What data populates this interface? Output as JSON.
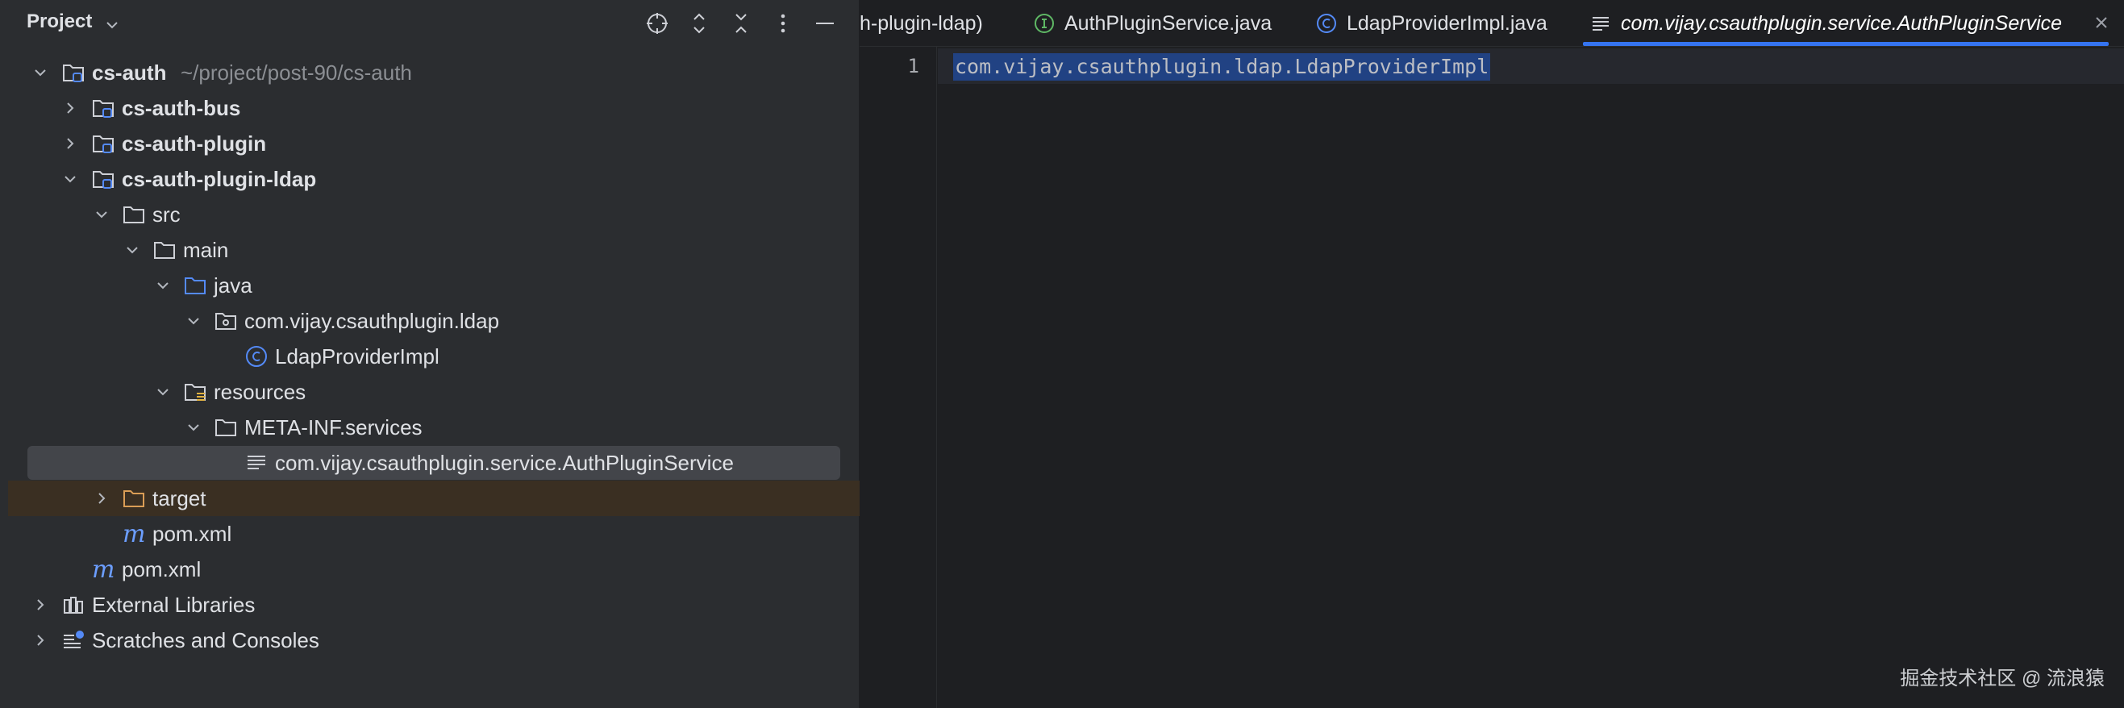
{
  "project_panel": {
    "title": "Project",
    "tree": [
      {
        "id": "cs-auth",
        "label": "cs-auth",
        "hint": "~/project/post-90/cs-auth",
        "icon": "module-folder-icon",
        "expanded": true,
        "bold": true
      },
      {
        "id": "cs-auth-bus",
        "label": "cs-auth-bus",
        "icon": "module-folder-icon",
        "expanded": false,
        "bold": true
      },
      {
        "id": "cs-auth-plugin",
        "label": "cs-auth-plugin",
        "icon": "module-folder-icon",
        "expanded": false,
        "bold": true
      },
      {
        "id": "cs-auth-plugin-ldap",
        "label": "cs-auth-plugin-ldap",
        "icon": "module-folder-icon",
        "expanded": true,
        "bold": true
      },
      {
        "id": "src",
        "label": "src",
        "icon": "folder-icon",
        "expanded": true
      },
      {
        "id": "main",
        "label": "main",
        "icon": "folder-icon",
        "expanded": true
      },
      {
        "id": "java",
        "label": "java",
        "icon": "source-folder-icon",
        "expanded": true
      },
      {
        "id": "package",
        "label": "com.vijay.csauthplugin.ldap",
        "icon": "package-icon",
        "expanded": true
      },
      {
        "id": "ldap-provider-impl",
        "label": "LdapProviderImpl",
        "icon": "class-icon"
      },
      {
        "id": "resources",
        "label": "resources",
        "icon": "resources-folder-icon",
        "expanded": true
      },
      {
        "id": "meta-inf-services",
        "label": "META-INF.services",
        "icon": "folder-icon",
        "expanded": true
      },
      {
        "id": "service-file",
        "label": "com.vijay.csauthplugin.service.AuthPluginService",
        "icon": "text-file-icon",
        "selected": true
      },
      {
        "id": "target",
        "label": "target",
        "icon": "excluded-folder-icon",
        "expanded": false
      },
      {
        "id": "pom-inner",
        "label": "pom.xml",
        "icon": "maven-icon"
      },
      {
        "id": "pom-root",
        "label": "pom.xml",
        "icon": "maven-icon"
      },
      {
        "id": "external-libraries",
        "label": "External Libraries",
        "icon": "libraries-icon",
        "expanded": false
      },
      {
        "id": "scratches",
        "label": "Scratches and Consoles",
        "icon": "scratches-icon",
        "expanded": false
      }
    ]
  },
  "editor": {
    "tabs": [
      {
        "label": "h-plugin-ldap)",
        "icon": ""
      },
      {
        "label": "AuthPluginService.java",
        "icon": "interface-icon"
      },
      {
        "label": "LdapProviderImpl.java",
        "icon": "class-icon"
      },
      {
        "label": "com.vijay.csauthplugin.service.AuthPluginService",
        "icon": "text-file-icon",
        "active": true
      }
    ],
    "line_number": "1",
    "code_line": "com.vijay.csauthplugin.ldap.LdapProviderImpl"
  },
  "watermark": "掘金技术社区 @ 流浪猿",
  "colors": {
    "panel_bg": "#2b2d30",
    "editor_bg": "#1e1f22",
    "selection": "#214283",
    "accent": "#3574f0",
    "folder_blue": "#548af7",
    "target_folder": "#d99d56"
  }
}
